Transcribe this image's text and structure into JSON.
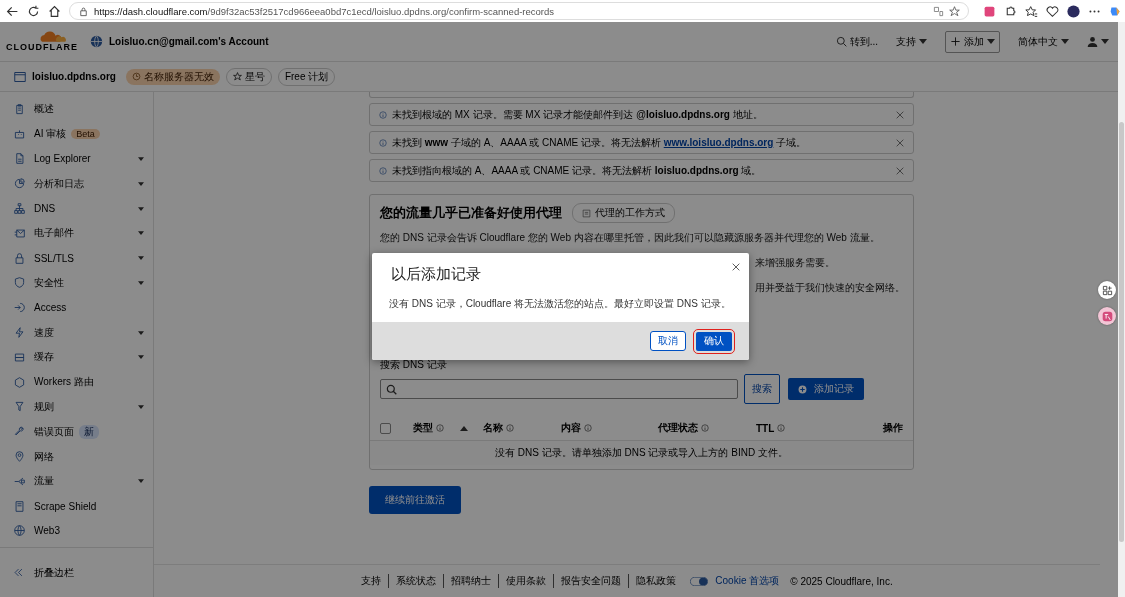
{
  "browser": {
    "url_host": "https://dash.cloudflare.com",
    "url_path": "/9d9f32ac53f2517cd966eea0bd7c1ecd/loisluo.dpdns.org/confirm-scanned-records"
  },
  "header": {
    "logo": "CLOUDFLARE",
    "account": "Loisluo.cn@gmail.com's Account",
    "goto": "转到...",
    "support": "支持",
    "add": "添加",
    "language": "简体中文"
  },
  "domain_bar": {
    "domain": "loisluo.dpdns.org",
    "status": "名称服务器无效",
    "star": "星号",
    "plan": "Free 计划"
  },
  "sidebar": {
    "items": [
      {
        "label": "概述",
        "has_menu": false
      },
      {
        "label": "AI 审核",
        "has_menu": false,
        "badge": {
          "text": "Beta",
          "kind": "beta"
        }
      },
      {
        "label": "Log Explorer",
        "has_menu": true
      },
      {
        "label": "分析和日志",
        "has_menu": true
      },
      {
        "label": "DNS",
        "has_menu": true
      },
      {
        "label": "电子邮件",
        "has_menu": true
      },
      {
        "label": "SSL/TLS",
        "has_menu": true
      },
      {
        "label": "安全性",
        "has_menu": true
      },
      {
        "label": "Access",
        "has_menu": false
      },
      {
        "label": "速度",
        "has_menu": true
      },
      {
        "label": "缓存",
        "has_menu": true
      },
      {
        "label": "Workers 路由",
        "has_menu": false
      },
      {
        "label": "规则",
        "has_menu": true
      },
      {
        "label": "错误页面",
        "has_menu": false,
        "badge": {
          "text": "新",
          "kind": "new"
        }
      },
      {
        "label": "网络",
        "has_menu": false
      },
      {
        "label": "流量",
        "has_menu": true
      },
      {
        "label": "Scrape Shield",
        "has_menu": false
      },
      {
        "label": "Web3",
        "has_menu": false
      }
    ],
    "collapse": "折叠边栏"
  },
  "alerts": [
    {
      "text": "未找到根域的 MX 记录。需要 MX 记录才能使邮件到达 @**loisluo.dpdns.org** 地址。"
    },
    {
      "text": "未找到 **www** 子域的 A、AAAA 或 CNAME 记录。将无法解析 ",
      "link": "www.loisluo.dpdns.org",
      "text_after": " 子域。"
    },
    {
      "text": "未找到指向根域的 A、AAAA 或 CNAME 记录。将无法解析 **loisluo.dpdns.org** 域。"
    }
  ],
  "card": {
    "title": "您的流量几乎已准备好使用代理",
    "how_link": "代理的工作方式",
    "paragraphs": [
      "您的 DNS 记录会告诉 Cloudflare 您的 Web 内容在哪里托管，因此我们可以隐藏源服务器并代理您的 Web 流量。",
      "来增强服务需要。",
      "用并受益于我们快速的安全网络。"
    ],
    "search_label": "搜索 DNS 记录",
    "select_all_checked": false,
    "search_button": "搜索",
    "add_record": "添加记录",
    "columns": [
      {
        "label": "类型",
        "info": true,
        "sortable": true
      },
      {
        "label": "名称",
        "info": true,
        "sortable": false
      },
      {
        "label": "内容",
        "info": true,
        "sortable": false
      },
      {
        "label": "代理状态",
        "info": true,
        "sortable": false
      },
      {
        "label": "TTL",
        "info": true,
        "sortable": false
      },
      {
        "label": "操作",
        "info": false,
        "sortable": false
      }
    ],
    "empty": "没有 DNS 记录。请单独添加 DNS 记录或导入上方的 BIND 文件。"
  },
  "continue": "继续前往激活",
  "footer": {
    "links": [
      "支持",
      "系统状态",
      "招聘纳士",
      "使用条款",
      "报告安全问题",
      "隐私政策"
    ],
    "cookie": "Cookie 首选项",
    "copyright": "© 2025 Cloudflare, Inc."
  },
  "modal": {
    "title": "以后添加记录",
    "body": "没有 DNS 记录，Cloudflare 将无法激活您的站点。最好立即设置 DNS 记录。",
    "cancel": "取消",
    "confirm": "确认",
    "confirm_highlighted": true
  }
}
